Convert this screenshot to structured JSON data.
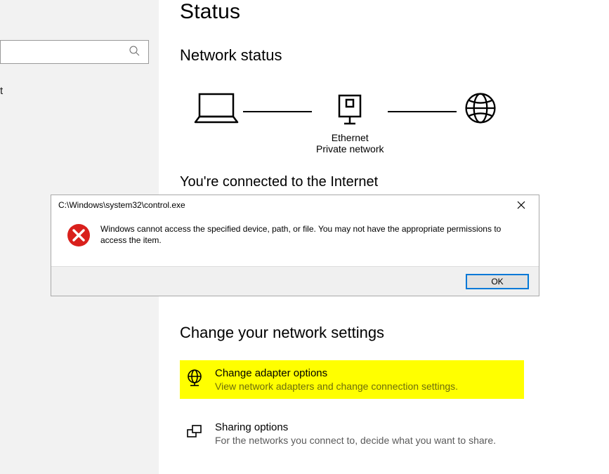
{
  "page": {
    "title": "Status"
  },
  "search": {
    "placeholder": ""
  },
  "left_fragment": "t",
  "network_status": {
    "heading": "Network status",
    "adapter_name": "Ethernet",
    "adapter_kind": "Private network",
    "connected_text": "You're connected to the Internet"
  },
  "dialog": {
    "title": "C:\\Windows\\system32\\control.exe",
    "message": "Windows cannot access the specified device, path, or file. You may not have the appropriate permissions to access the item.",
    "ok_label": "OK"
  },
  "change_settings": {
    "heading": "Change your network settings",
    "items": [
      {
        "title": "Change adapter options",
        "sub": "View network adapters and change connection settings."
      },
      {
        "title": "Sharing options",
        "sub": "For the networks you connect to, decide what you want to share."
      }
    ]
  }
}
